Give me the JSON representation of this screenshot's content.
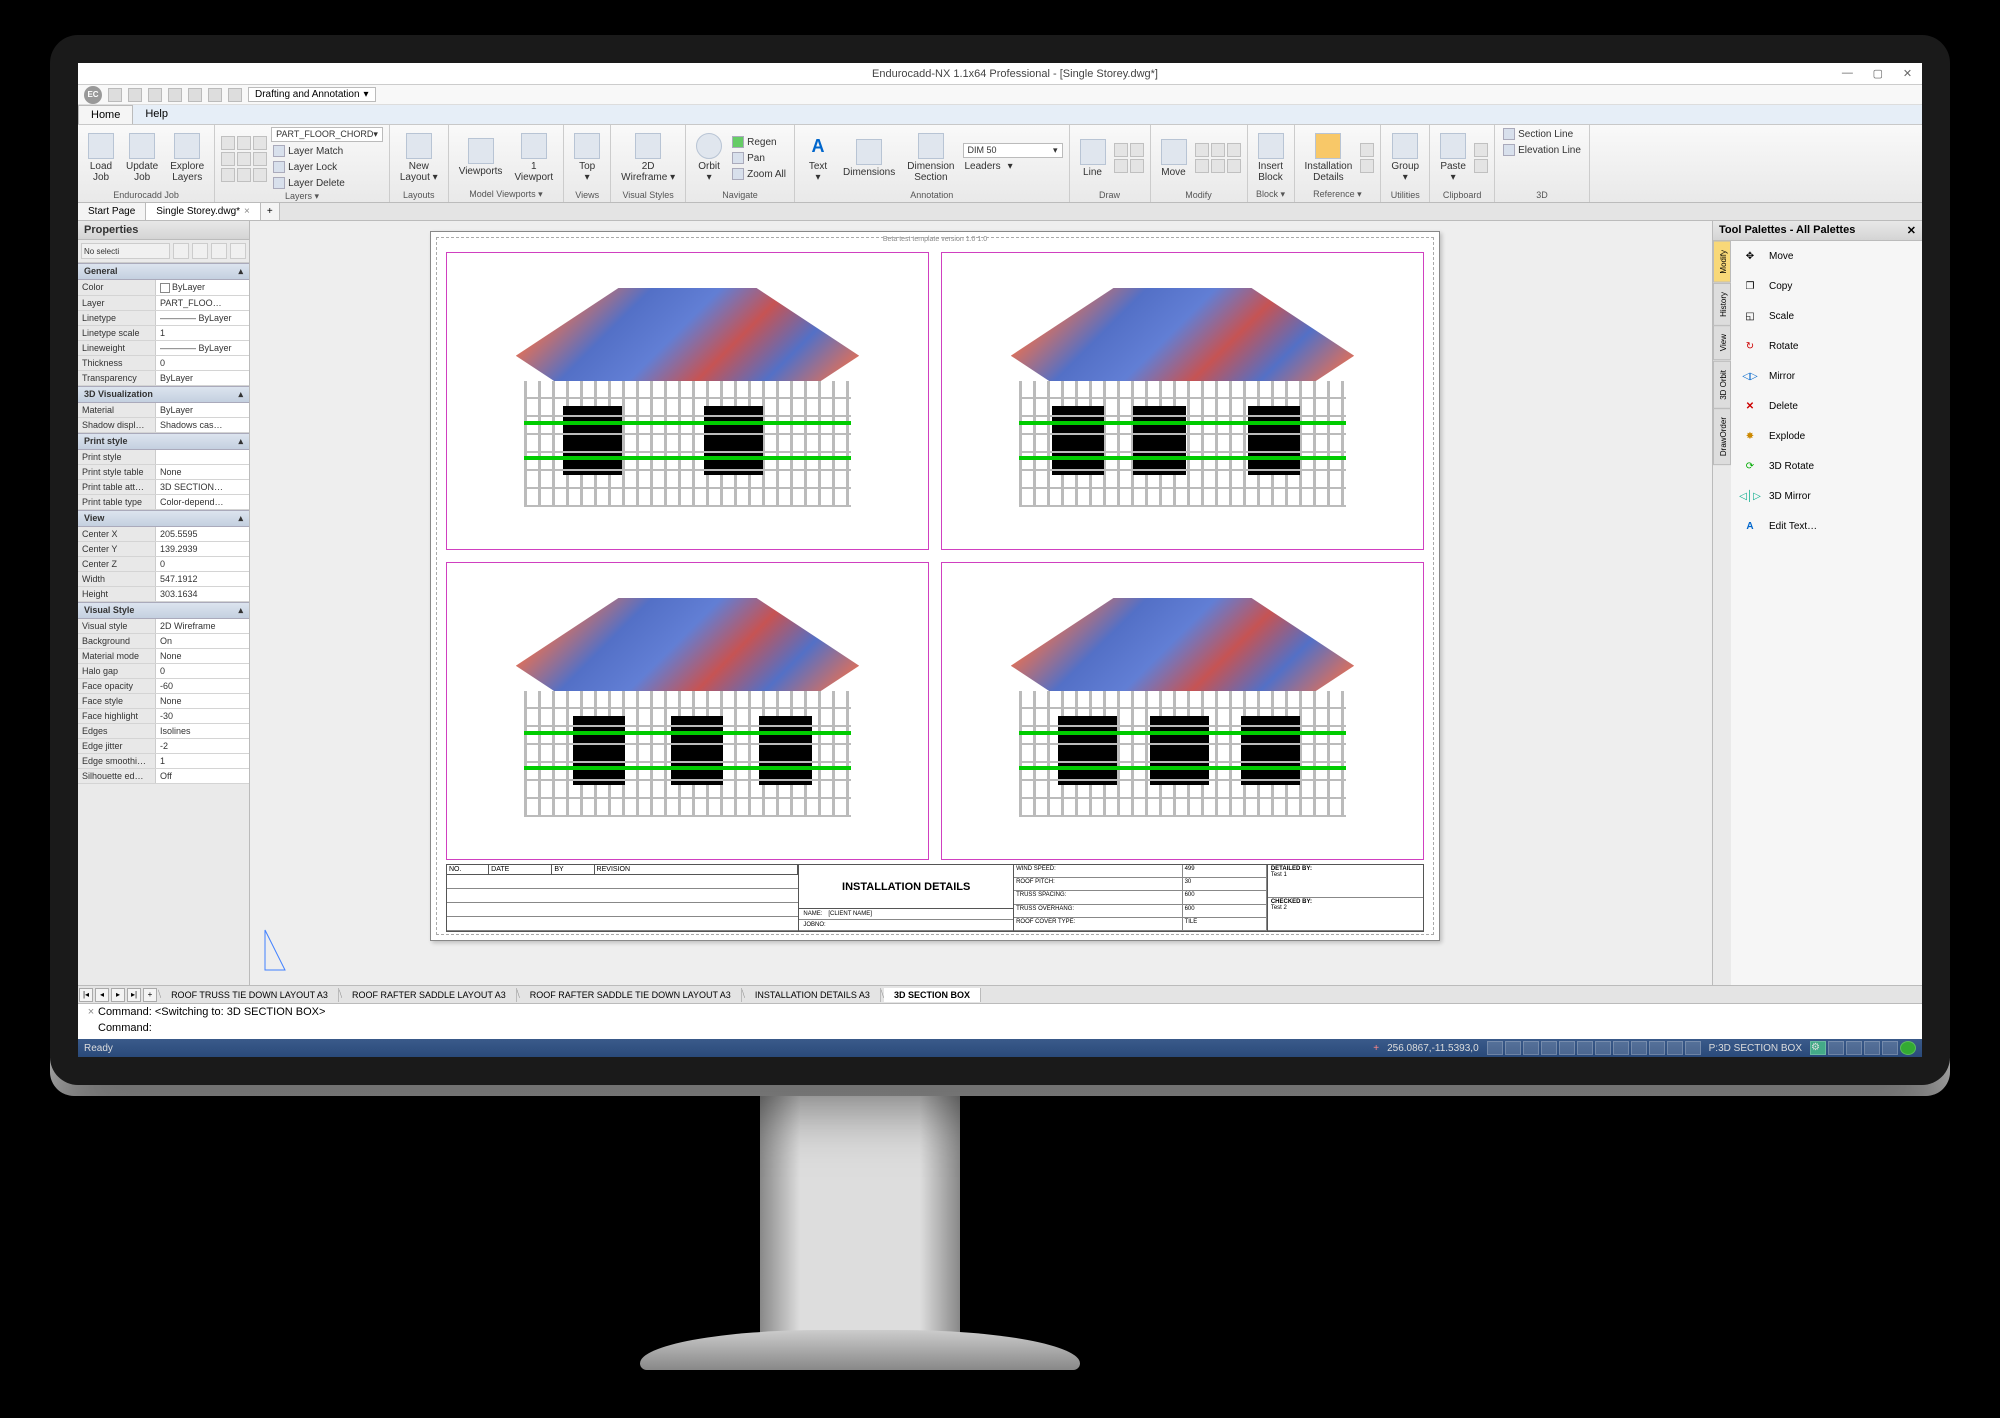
{
  "title": "Endurocadd-NX 1.1x64 Professional - [Single Storey.dwg*]",
  "qat": {
    "logo": "EC",
    "workspace": "Drafting and Annotation"
  },
  "menu": {
    "home": "Home",
    "help": "Help"
  },
  "ribbon": {
    "endurocadd": {
      "label": "Endurocadd Job",
      "load": "Load\nJob",
      "update": "Update\nJob",
      "explore": "Explore\nLayers"
    },
    "layers": {
      "label": "Layers ▾",
      "partfloor": "PART_FLOOR_CHORD",
      "match": "Layer Match",
      "lock": "Layer Lock",
      "delete": "Layer Delete"
    },
    "layouts": {
      "label": "Layouts",
      "new": "New\nLayout ▾"
    },
    "mvp": {
      "label": "Model Viewports ▾",
      "vp": "Viewports",
      "one": "1\nViewport"
    },
    "views": {
      "label": "Views",
      "top": "Top\n▾"
    },
    "vstyle": {
      "label": "Visual Styles",
      "wf": "2D\nWireframe ▾"
    },
    "nav": {
      "label": "Navigate",
      "orbit": "Orbit\n▾",
      "regen": "Regen",
      "pan": "Pan",
      "zoom": "Zoom All"
    },
    "anno": {
      "label": "Annotation",
      "text": "Text\n▾",
      "dim": "Dimensions",
      "dimsec": "Dimension\nSection",
      "dim50": "DIM 50",
      "leaders": "Leaders"
    },
    "draw": {
      "label": "Draw",
      "line": "Line"
    },
    "modify": {
      "label": "Modify",
      "move": "Move"
    },
    "block": {
      "label": "Block ▾",
      "insert": "Insert\nBlock"
    },
    "reference": {
      "label": "Reference ▾",
      "inst": "Installation\nDetails"
    },
    "util": {
      "label": "Utilities",
      "group": "Group\n▾"
    },
    "clip": {
      "label": "Clipboard",
      "paste": "Paste\n▾"
    },
    "threeD": {
      "label": "3D",
      "secline": "Section Line",
      "elevline": "Elevation Line"
    }
  },
  "doctabs": {
    "start": "Start Page",
    "file": "Single Storey.dwg*"
  },
  "props": {
    "title": "Properties",
    "nosel": "No selecti",
    "general": {
      "hdr": "General",
      "color_k": "Color",
      "color_v": "ByLayer",
      "layer_k": "Layer",
      "layer_v": "PART_FLOO…",
      "lt_k": "Linetype",
      "lt_v": "———— ByLayer",
      "lts_k": "Linetype scale",
      "lts_v": "1",
      "lw_k": "Lineweight",
      "lw_v": "———— ByLayer",
      "thk_k": "Thickness",
      "thk_v": "0",
      "trn_k": "Transparency",
      "trn_v": "ByLayer"
    },
    "vis3d": {
      "hdr": "3D Visualization",
      "mat_k": "Material",
      "mat_v": "ByLayer",
      "shd_k": "Shadow displ…",
      "shd_v": "Shadows cas…"
    },
    "pstyle": {
      "hdr": "Print style",
      "ps_k": "Print style",
      "ps_v": "",
      "pst_k": "Print style table",
      "pst_v": "None",
      "pta_k": "Print table att…",
      "pta_v": "3D SECTION…",
      "ptt_k": "Print table type",
      "ptt_v": "Color-depend…"
    },
    "view": {
      "hdr": "View",
      "cx_k": "Center X",
      "cx_v": "205.5595",
      "cy_k": "Center Y",
      "cy_v": "139.2939",
      "cz_k": "Center Z",
      "cz_v": "0",
      "w_k": "Width",
      "w_v": "547.1912",
      "h_k": "Height",
      "h_v": "303.1634"
    },
    "vstyle": {
      "hdr": "Visual Style",
      "vs_k": "Visual style",
      "vs_v": "2D Wireframe",
      "bg_k": "Background",
      "bg_v": "On",
      "mm_k": "Material mode",
      "mm_v": "None",
      "hg_k": "Halo gap",
      "hg_v": "0",
      "fo_k": "Face opacity",
      "fo_v": "-60",
      "fs_k": "Face style",
      "fs_v": "None",
      "fh_k": "Face highlight",
      "fh_v": "-30",
      "ed_k": "Edges",
      "ed_v": "Isolines",
      "ej_k": "Edge jitter",
      "ej_v": "-2",
      "es_k": "Edge smoothi…",
      "es_v": "1",
      "se_k": "Silhouette ed…",
      "se_v": "Off"
    }
  },
  "canvas": {
    "template": "Beta test template version 1.0 1.0",
    "tb_rev": {
      "no": "NO.",
      "date": "DATE",
      "by": "BY",
      "rev": "REVISION"
    },
    "tb_title": "INSTALLATION DETAILS",
    "tb_name_k": "NAME:",
    "tb_name_v": "[CLIENT NAME]",
    "tb_jobno": "JOBNO:",
    "tb_r": {
      "ws": "WIND SPEED:",
      "ws_v": "499",
      "rp": "ROOF PITCH:",
      "rp_v": "30",
      "ts": "TRUSS SPACING:",
      "ts_v": "600",
      "to": "TRUSS OVERHANG:",
      "to_v": "600",
      "rc": "ROOF COVER TYPE:",
      "rc_v": "TILE"
    },
    "tb_r2": {
      "det": "DETAILED BY:",
      "det_v": "Test 1",
      "chk": "CHECKED BY:",
      "chk_v": "Test 2"
    }
  },
  "palettes": {
    "title": "Tool Palettes - All Palettes",
    "tabs": {
      "modify": "Modify",
      "history": "History",
      "view": "View",
      "orbit": "3D Orbit",
      "draworder": "DrawOrder"
    },
    "items": {
      "move": "Move",
      "copy": "Copy",
      "scale": "Scale",
      "rotate": "Rotate",
      "mirror": "Mirror",
      "delete": "Delete",
      "explode": "Explode",
      "rot3d": "3D Rotate",
      "mir3d": "3D Mirror",
      "edit": "Edit Text…"
    }
  },
  "layouts": {
    "t1": "ROOF TRUSS TIE DOWN LAYOUT A3",
    "t2": "ROOF RAFTER SADDLE LAYOUT A3",
    "t3": "ROOF RAFTER SADDLE TIE DOWN LAYOUT A3",
    "t4": "INSTALLATION DETAILS A3",
    "t5": "3D SECTION BOX"
  },
  "cmd": {
    "l1": "Command: <Switching to: 3D SECTION BOX>",
    "l2": "Command:"
  },
  "status": {
    "ready": "Ready",
    "coords": "256.0867,-11.5393,0",
    "layout": "P:3D SECTION BOX"
  }
}
